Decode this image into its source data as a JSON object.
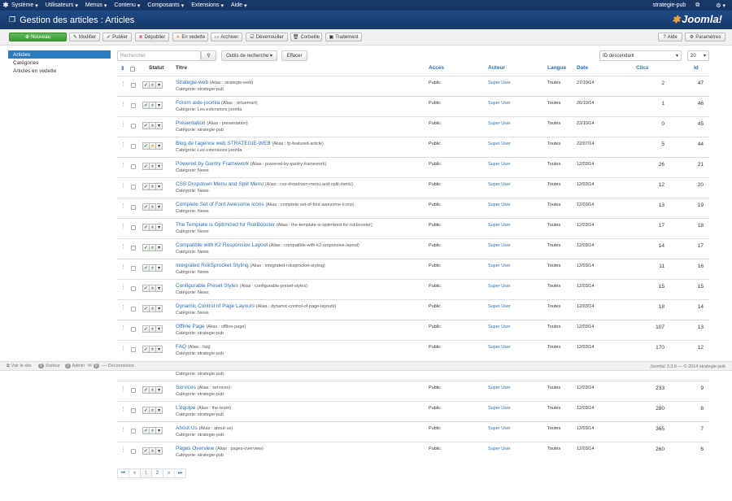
{
  "topnav": {
    "menu": [
      "Système",
      "Utilisateurs",
      "Menus",
      "Contenu",
      "Composants",
      "Extensions",
      "Aide"
    ],
    "site": "strategie-pub",
    "site_icon": "external-link-icon",
    "user_icon": "gear-icon"
  },
  "header": {
    "title": "Gestion des articles : Articles",
    "brand": "Joomla!"
  },
  "toolbar": {
    "new": "Nouveau",
    "edit": "Modifier",
    "publish": "Publier",
    "unpublish": "Dépublier",
    "featured": "En vedette",
    "archive": "Archiver",
    "checkin": "Déverrouiller",
    "trash": "Corbeille",
    "batch": "Traitement",
    "help": "Aide",
    "options": "Paramètres"
  },
  "sidebar": {
    "items": [
      "Articles",
      "Catégories",
      "Articles en vedette"
    ]
  },
  "filters": {
    "search_placeholder": "Rechercher",
    "search_tools": "Outils de recherche",
    "clear": "Effacer",
    "sort": "ID descendant",
    "limit": "20"
  },
  "columns": {
    "status": "Statut",
    "title": "Titre",
    "access": "Accès",
    "author": "Auteur",
    "language": "Langue",
    "date": "Date",
    "hits": "Clics",
    "id": "Id"
  },
  "rows": [
    {
      "title": "Strategie-web",
      "alias": "(Alias : strategie-web)",
      "category": "Catégorie: strategie-pub",
      "access": "Public",
      "author": "Super User",
      "language": "Toutes",
      "date": "27/10/14",
      "hits": "2",
      "id": "47",
      "featured": false
    },
    {
      "title": "Forum aide-joomla",
      "alias": "(Alias : virtuemart)",
      "category": "Catégorie: Les extensions joomla",
      "access": "Public",
      "author": "Super User",
      "language": "Toutes",
      "date": "26/10/14",
      "hits": "1",
      "id": "46",
      "featured": false
    },
    {
      "title": "Présentation",
      "alias": "(Alias : presentation)",
      "category": "Catégorie: strategie-pub",
      "access": "Public",
      "author": "Super User",
      "language": "Toutes",
      "date": "23/10/14",
      "hits": "0",
      "id": "45",
      "featured": false
    },
    {
      "title": "Blog de l'agence web STRATEGIE-WEB",
      "alias": "(Alias : fp-featured-article)",
      "category": "Catégorie: Les extensions joomla",
      "access": "Public",
      "author": "Super User",
      "language": "Toutes",
      "date": "22/07/14",
      "hits": "5",
      "id": "44",
      "featured": true
    },
    {
      "title": "Powered by Gantry Framework",
      "alias": "(Alias : powered-by-gantry-framework)",
      "category": "Catégorie: News",
      "access": "Public",
      "author": "Super User",
      "language": "Toutes",
      "date": "12/03/14",
      "hits": "26",
      "id": "21",
      "featured": false
    },
    {
      "title": "CSS Dropdown Menu and Split Menu",
      "alias": "(Alias : css-dropdown-menu-and-split-menu)",
      "category": "Catégorie: News",
      "access": "Public",
      "author": "Super User",
      "language": "Toutes",
      "date": "12/03/14",
      "hits": "12",
      "id": "20",
      "featured": false
    },
    {
      "title": "Complete Set of Font Awesome Icons",
      "alias": "(Alias : complete-set-of-font-awesome-icons)",
      "category": "Catégorie: News",
      "access": "Public",
      "author": "Super User",
      "language": "Toutes",
      "date": "12/03/14",
      "hits": "13",
      "id": "19",
      "featured": false
    },
    {
      "title": "The Template is Optimized for RokBooster",
      "alias": "(Alias : the-template-is-optimized-for-rokbooster)",
      "category": "Catégorie: News",
      "access": "Public",
      "author": "Super User",
      "language": "Toutes",
      "date": "12/03/14",
      "hits": "17",
      "id": "18",
      "featured": false
    },
    {
      "title": "Compatible with K2 Responsive Layout",
      "alias": "(Alias : compatible-with-k2-responsive-layout)",
      "category": "Catégorie: News",
      "access": "Public",
      "author": "Super User",
      "language": "Toutes",
      "date": "12/03/14",
      "hits": "14",
      "id": "17",
      "featured": false
    },
    {
      "title": "Integrated RokSprocket Styling",
      "alias": "(Alias : integrated-roksprocket-styling)",
      "category": "Catégorie: News",
      "access": "Public",
      "author": "Super User",
      "language": "Toutes",
      "date": "12/03/14",
      "hits": "11",
      "id": "16",
      "featured": false
    },
    {
      "title": "Configurable Preset Styles",
      "alias": "(Alias : configurable-preset-styles)",
      "category": "Catégorie: News",
      "access": "Public",
      "author": "Super User",
      "language": "Toutes",
      "date": "12/03/14",
      "hits": "15",
      "id": "15",
      "featured": false
    },
    {
      "title": "Dynamic Control of Page Layouts",
      "alias": "(Alias : dynamic-control-of-page-layouts)",
      "category": "Catégorie: News",
      "access": "Public",
      "author": "Super User",
      "language": "Toutes",
      "date": "12/03/14",
      "hits": "18",
      "id": "14",
      "featured": false
    },
    {
      "title": "Offline Page",
      "alias": "(Alias : offline-page)",
      "category": "Catégorie: strategie-pub",
      "access": "Public",
      "author": "Super User",
      "language": "Toutes",
      "date": "12/03/14",
      "hits": "107",
      "id": "13",
      "featured": false
    },
    {
      "title": "FAQ",
      "alias": "(Alias : faq)",
      "category": "Catégorie: strategie-pub",
      "access": "Public",
      "author": "Super User",
      "language": "Toutes",
      "date": "12/03/14",
      "hits": "170",
      "id": "12",
      "featured": false
    },
    {
      "title": "",
      "alias": "",
      "category": "Catégorie: strategie-pub",
      "access": "",
      "author": "",
      "language": "",
      "date": "",
      "hits": "",
      "id": "",
      "featured": false
    },
    {
      "title": "Services",
      "alias": "(Alias : services)",
      "category": "Catégorie: strategie-pub",
      "access": "Public",
      "author": "Super User",
      "language": "Toutes",
      "date": "12/03/14",
      "hits": "233",
      "id": "9",
      "featured": false
    },
    {
      "title": "L'équipe",
      "alias": "(Alias : the-team)",
      "category": "Catégorie: strategie-pub",
      "access": "Public",
      "author": "Super User",
      "language": "Toutes",
      "date": "12/03/14",
      "hits": "280",
      "id": "8",
      "featured": false
    },
    {
      "title": "About Us",
      "alias": "(Alias : about-us)",
      "category": "Catégorie: strategie-pub",
      "access": "Public",
      "author": "Super User",
      "language": "Toutes",
      "date": "12/03/14",
      "hits": "365",
      "id": "7",
      "featured": false
    },
    {
      "title": "Pages Overview",
      "alias": "(Alias : pages-overview)",
      "category": "Catégorie: strategie-pub",
      "access": "Public",
      "author": "Super User",
      "language": "Toutes",
      "date": "12/03/14",
      "hits": "260",
      "id": "6",
      "featured": false
    }
  ],
  "statusbar": {
    "view_site": "Voir le site",
    "visitors_count": "1",
    "visitors": "Visiteur",
    "admins_count": "1",
    "admins": "Admin",
    "messages_count": "0",
    "logout": "Déconnexion",
    "version": "Joomla! 3.3.6 — © 2014 strategie-pub"
  },
  "pagination": [
    "⏮",
    "«",
    "1",
    "2",
    "»",
    "⏭"
  ],
  "colors": {
    "accent": "#2a6fb6",
    "header": "#1a3867",
    "new_button": "#4aa842",
    "featured": "#f4a33a"
  }
}
